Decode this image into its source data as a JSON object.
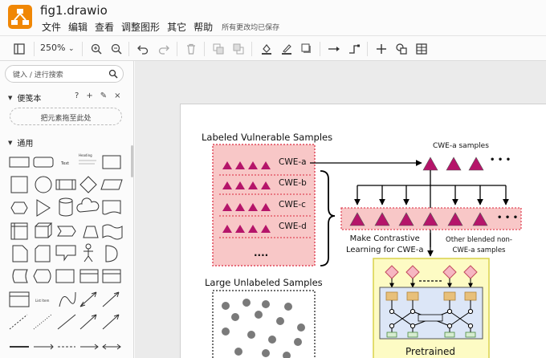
{
  "app": {
    "title": "fig1.drawio",
    "logo_color": "#f08705",
    "menu": [
      "文件",
      "编辑",
      "查看",
      "调整图形",
      "其它",
      "帮助"
    ],
    "save_status": "所有更改均已保存"
  },
  "toolbar": {
    "zoom": "250%",
    "icons": [
      "sidebar-toggle-icon",
      "zoom-in-icon",
      "zoom-out-icon",
      "undo-icon",
      "redo-icon",
      "delete-icon",
      "to-front-icon",
      "to-back-icon",
      "fill-color-icon",
      "line-color-icon",
      "shadow-icon",
      "connection-icon",
      "waypoints-icon",
      "insert-icon",
      "duplicate-icon",
      "table-icon"
    ]
  },
  "sidebar": {
    "search_placeholder": "键入 / 进行搜索",
    "scratchpad": {
      "label": "便笺本",
      "actions": [
        "?",
        "+",
        "✎",
        "×"
      ],
      "drop_hint": "把元素拖至此处"
    },
    "general": {
      "label": "通用"
    },
    "shape_labels": {
      "text": "Text",
      "heading": "Heading",
      "list": "List Item"
    }
  },
  "diagram": {
    "labeled_title": "Labeled Vulnerable Samples",
    "cwe_rows": [
      "CWE-a",
      "CWE-b",
      "CWE-c",
      "CWE-d"
    ],
    "ellipsis": "....",
    "cwe_a_samples": "CWE-a samples",
    "dots": "• • •",
    "contrastive_line1": "Make Contrastive",
    "contrastive_line2": "Learning for CWE-a",
    "blended_line1": "Other blended non-",
    "blended_line2": "CWE-a samples",
    "unlabeled_title": "Large Unlabeled Samples",
    "pretrained": "Pretrained",
    "colors": {
      "pink_fill": "#f8c7c7",
      "pink_border": "#e0495a",
      "triangle": "#b5156a",
      "yellow_fill": "#fdfbc4",
      "yellow_border": "#d8d24a",
      "model_fill": "#dce6f7",
      "diamond_fill": "#f6b6c2",
      "node_orange": "#e8c07a",
      "node_green": "#d6ecd0",
      "dot_gray": "#7a7a7a"
    }
  }
}
